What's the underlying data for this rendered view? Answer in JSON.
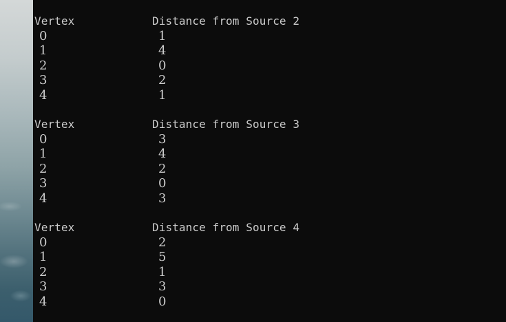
{
  "terminal": {
    "blocks": [
      {
        "header_vertex": "Vertex",
        "header_distance": "Distance from Source 2",
        "rows": [
          {
            "vertex": "0",
            "distance": "1"
          },
          {
            "vertex": "1",
            "distance": "4"
          },
          {
            "vertex": "2",
            "distance": "0"
          },
          {
            "vertex": "3",
            "distance": "2"
          },
          {
            "vertex": "4",
            "distance": "1"
          }
        ]
      },
      {
        "header_vertex": "Vertex",
        "header_distance": "Distance from Source 3",
        "rows": [
          {
            "vertex": "0",
            "distance": "3"
          },
          {
            "vertex": "1",
            "distance": "4"
          },
          {
            "vertex": "2",
            "distance": "2"
          },
          {
            "vertex": "3",
            "distance": "0"
          },
          {
            "vertex": "4",
            "distance": "3"
          }
        ]
      },
      {
        "header_vertex": "Vertex",
        "header_distance": "Distance from Source 4",
        "rows": [
          {
            "vertex": "0",
            "distance": "2"
          },
          {
            "vertex": "1",
            "distance": "5"
          },
          {
            "vertex": "2",
            "distance": "1"
          },
          {
            "vertex": "3",
            "distance": "3"
          },
          {
            "vertex": "4",
            "distance": "0"
          }
        ]
      }
    ]
  }
}
